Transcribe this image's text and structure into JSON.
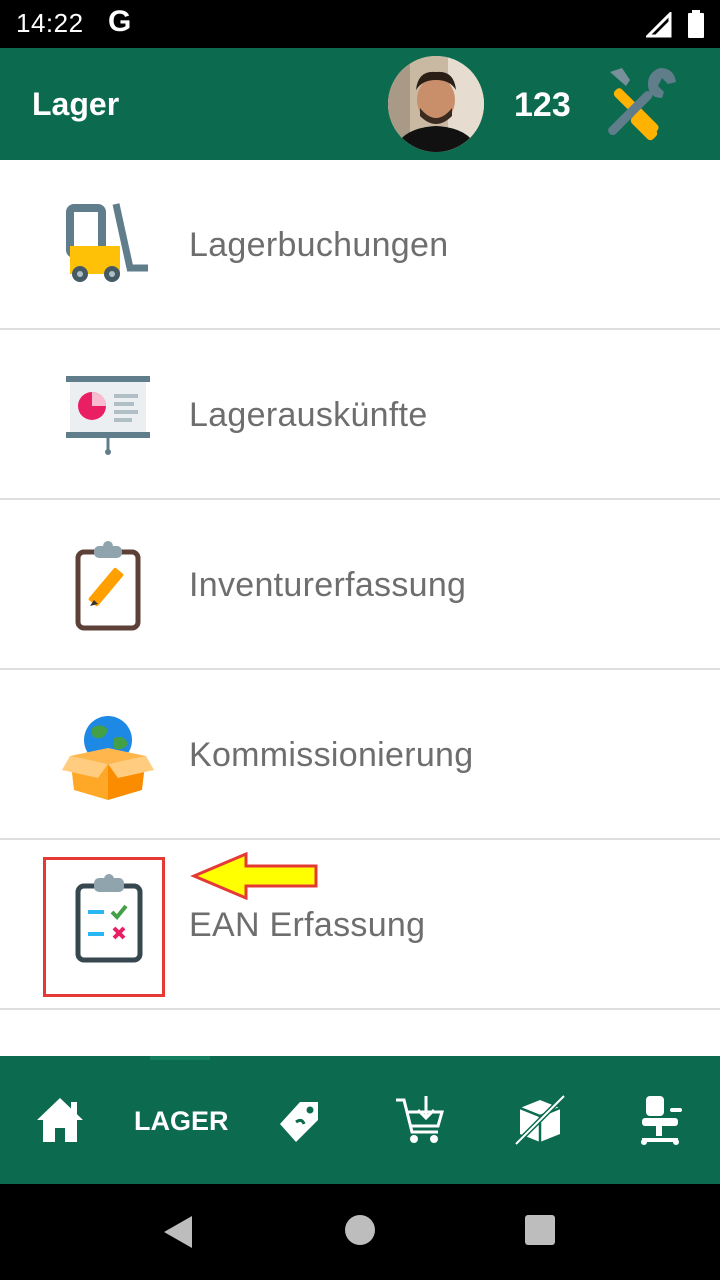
{
  "status_bar": {
    "time": "14:22",
    "carrier_glyph": "G",
    "icons": [
      "signal-icon",
      "battery-icon"
    ]
  },
  "app_bar": {
    "title": "Lager",
    "user_number": "123",
    "settings_icon": "tools-icon"
  },
  "menu": {
    "items": [
      {
        "label": "Lagerbuchungen",
        "icon": "forklift-icon"
      },
      {
        "label": "Lagerauskünfte",
        "icon": "presentation-icon"
      },
      {
        "label": "Inventurerfassung",
        "icon": "clipboard-pencil-icon"
      },
      {
        "label": "Kommissionierung",
        "icon": "globe-box-icon"
      },
      {
        "label": "EAN Erfassung",
        "icon": "checklist-clipboard-icon"
      }
    ]
  },
  "bottom_nav": {
    "active_label": "LAGER",
    "items": [
      "home-icon",
      "lager",
      "tag-icon",
      "cart-icon",
      "box-icon",
      "chair-icon"
    ]
  },
  "colors": {
    "primary": "#0c6a4f",
    "label": "#6e6e6e",
    "highlight": "#e53935",
    "arrow": "#ffff00"
  }
}
